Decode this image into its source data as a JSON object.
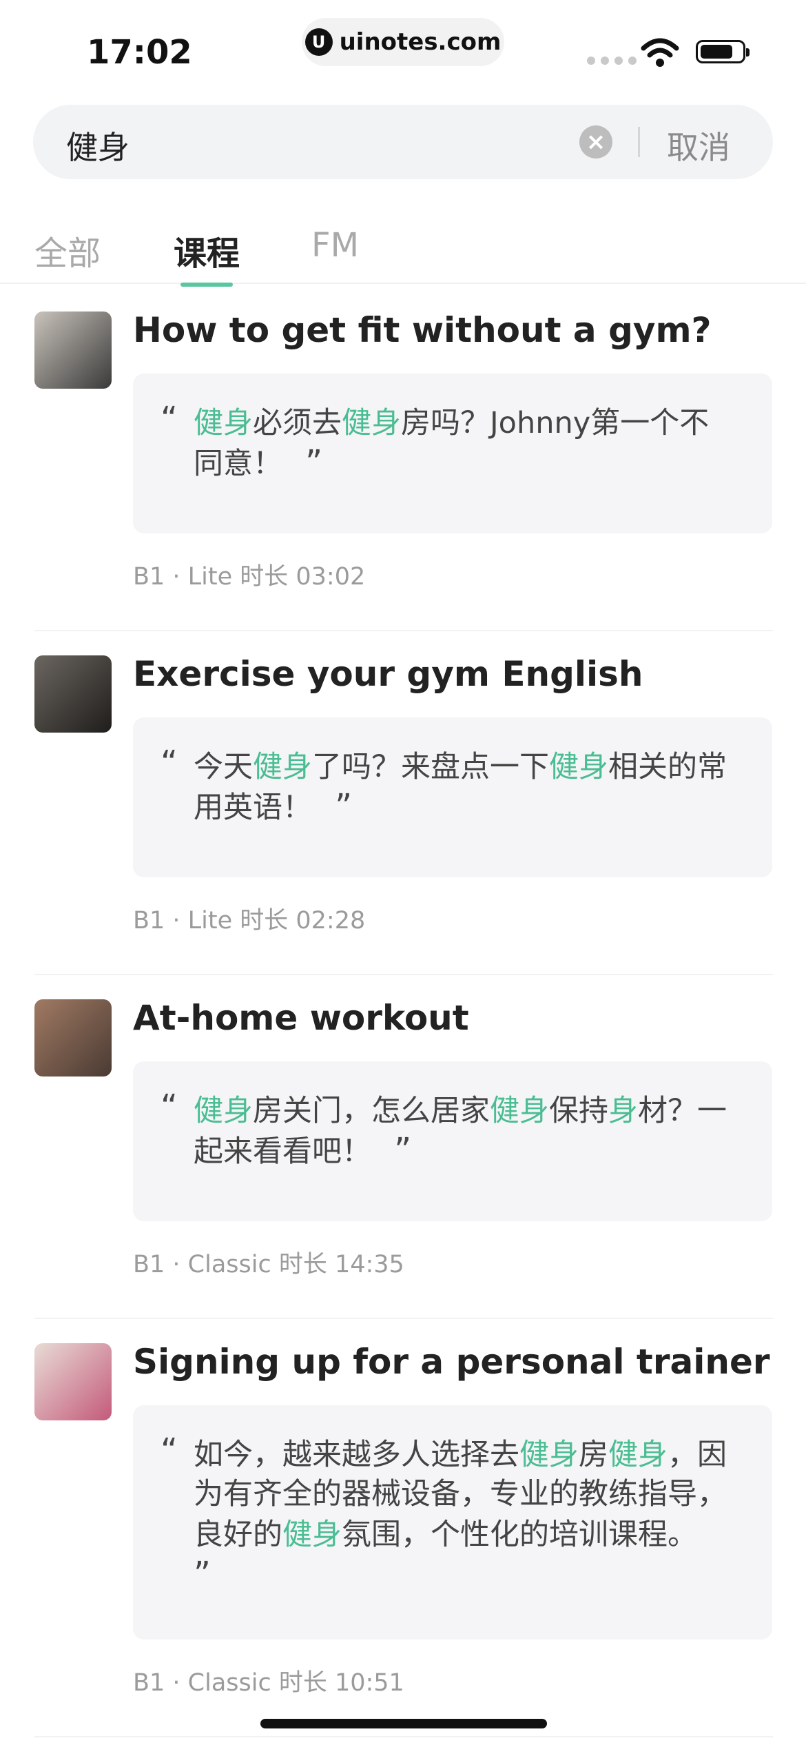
{
  "status_bar": {
    "time": "17:02",
    "url": "uinotes.com",
    "logo_letter": "U",
    "battery_level": 0.8
  },
  "search": {
    "value": "健身",
    "cancel_label": "取消",
    "clear_icon": "×"
  },
  "tabs": [
    {
      "label": "全部",
      "active": false
    },
    {
      "label": "课程",
      "active": true
    },
    {
      "label": "FM",
      "active": false
    }
  ],
  "courses": [
    {
      "title": "How to get fit without a gym?",
      "quote_parts": [
        {
          "t": "健身",
          "hl": true
        },
        {
          "t": "必须去",
          "hl": false
        },
        {
          "t": "健身",
          "hl": true
        },
        {
          "t": "房吗？Johnny第一个不同意！",
          "hl": false
        }
      ],
      "meta": "B1 · Lite 时长 03:02",
      "thumb_colors": [
        "#c9c3bb",
        "#3a3a3a"
      ]
    },
    {
      "title": "Exercise your gym English",
      "quote_parts": [
        {
          "t": "今天",
          "hl": false
        },
        {
          "t": "健身",
          "hl": true
        },
        {
          "t": "了吗？来盘点一下",
          "hl": false
        },
        {
          "t": "健身",
          "hl": true
        },
        {
          "t": "相关的常用英语！",
          "hl": false
        }
      ],
      "meta": "B1 · Lite 时长 02:28",
      "thumb_colors": [
        "#6b6660",
        "#1f1d1b"
      ]
    },
    {
      "title": "At-home workout",
      "quote_parts": [
        {
          "t": "健身",
          "hl": true
        },
        {
          "t": "房关门，怎么居家",
          "hl": false
        },
        {
          "t": "健身",
          "hl": true
        },
        {
          "t": "保持",
          "hl": false
        },
        {
          "t": "身",
          "hl": true
        },
        {
          "t": "材？一起来看看吧！",
          "hl": false
        }
      ],
      "meta": "B1 · Classic 时长 14:35",
      "thumb_colors": [
        "#a07a63",
        "#4a3a33"
      ]
    },
    {
      "title": "Signing up for a personal trainer",
      "quote_parts": [
        {
          "t": "如今，越来越多人选择去",
          "hl": false
        },
        {
          "t": "健身",
          "hl": true
        },
        {
          "t": "房",
          "hl": false
        },
        {
          "t": "健身",
          "hl": true
        },
        {
          "t": "，因为有齐全的器械设备，专业的教练指导，良好的",
          "hl": false
        },
        {
          "t": "健身",
          "hl": true
        },
        {
          "t": "氛围，个性化的培训课程。",
          "hl": false
        }
      ],
      "meta": "B1 · Classic 时长 10:51",
      "thumb_colors": [
        "#e8dcd6",
        "#c45a7a"
      ]
    }
  ]
}
